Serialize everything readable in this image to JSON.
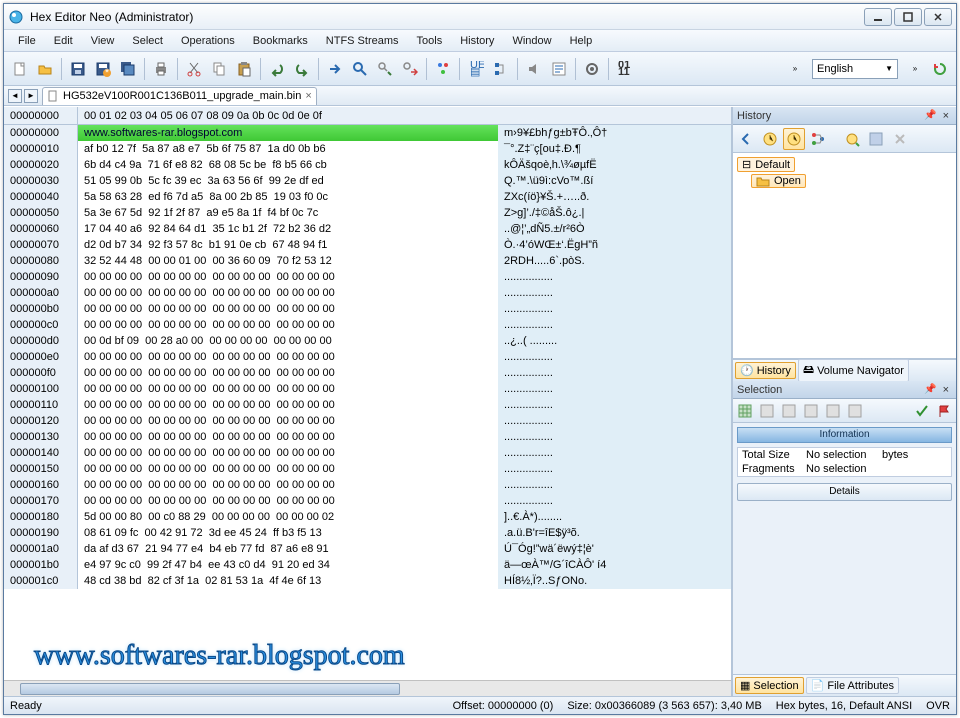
{
  "window": {
    "title": "Hex Editor Neo (Administrator)"
  },
  "menus": [
    "File",
    "Edit",
    "View",
    "Select",
    "Operations",
    "Bookmarks",
    "NTFS Streams",
    "Tools",
    "History",
    "Window",
    "Help"
  ],
  "language": "English",
  "tab": {
    "filename": "HG532eV100R001C136B011_upgrade_main.bin"
  },
  "hex": {
    "offset_header": "00000000",
    "col_header": "00 01 02 03  04 05 06 07  08 09 0a 0b  0c 0d 0e 0f",
    "rows": [
      {
        "off": "00000000",
        "b": "www.softwares-rar.blogspot.com",
        "a": "m›9¥£bhƒg±bŦÔ.‚Ô†"
      },
      {
        "off": "00000010",
        "b": "af b0 12 7f  5a 87 a8 e7  5b 6f 75 87  1a d0 0b b6",
        "a": "¯°.Z‡¨ç[ou‡.Ð.¶"
      },
      {
        "off": "00000020",
        "b": "6b d4 c4 9a  71 6f e8 82  68 08 5c be  f8 b5 66 cb",
        "a": "kÔÄšqoè‚h.\\¾øµfË"
      },
      {
        "off": "00000030",
        "b": "51 05 99 0b  5c fc 39 ec  3a 63 56 6f  99 2e df ed",
        "a": "Q.™.\\ü9ì:cVo™.ßí"
      },
      {
        "off": "00000040",
        "b": "5a 58 63 28  ed f6 7d a5  8a 00 2b 85  19 03 f0 0c",
        "a": "ZXc(íö}¥Š.+…..ð."
      },
      {
        "off": "00000050",
        "b": "5a 3e 67 5d  92 1f 2f 87  a9 e5 8a 1f  f4 bf 0c 7c",
        "a": "Z>g]’./‡©åŠ.ô¿.|"
      },
      {
        "off": "00000060",
        "b": "17 04 40 a6  92 84 64 d1  35 1c b1 2f  72 b2 36 d2",
        "a": "..@¦’„dÑ5.±/r²6Ò"
      },
      {
        "off": "00000070",
        "b": "d2 0d b7 34  92 f3 57 8c  b1 91 0e cb  67 48 94 f1",
        "a": "Ò.·4’óWŒ±‘.ËgH”ñ"
      },
      {
        "off": "00000080",
        "b": "32 52 44 48  00 00 01 00  00 36 60 09  70 f2 53 12",
        "a": "2RDH.....6`.pòS."
      },
      {
        "off": "00000090",
        "b": "00 00 00 00  00 00 00 00  00 00 00 00  00 00 00 00",
        "a": "................"
      },
      {
        "off": "000000a0",
        "b": "00 00 00 00  00 00 00 00  00 00 00 00  00 00 00 00",
        "a": "................"
      },
      {
        "off": "000000b0",
        "b": "00 00 00 00  00 00 00 00  00 00 00 00  00 00 00 00",
        "a": "................"
      },
      {
        "off": "000000c0",
        "b": "00 00 00 00  00 00 00 00  00 00 00 00  00 00 00 00",
        "a": "................"
      },
      {
        "off": "000000d0",
        "b": "00 0d bf 09  00 28 a0 00  00 00 00 00  00 00 00 00",
        "a": "..¿..( ........."
      },
      {
        "off": "000000e0",
        "b": "00 00 00 00  00 00 00 00  00 00 00 00  00 00 00 00",
        "a": "................"
      },
      {
        "off": "000000f0",
        "b": "00 00 00 00  00 00 00 00  00 00 00 00  00 00 00 00",
        "a": "................"
      },
      {
        "off": "00000100",
        "b": "00 00 00 00  00 00 00 00  00 00 00 00  00 00 00 00",
        "a": "................"
      },
      {
        "off": "00000110",
        "b": "00 00 00 00  00 00 00 00  00 00 00 00  00 00 00 00",
        "a": "................"
      },
      {
        "off": "00000120",
        "b": "00 00 00 00  00 00 00 00  00 00 00 00  00 00 00 00",
        "a": "................"
      },
      {
        "off": "00000130",
        "b": "00 00 00 00  00 00 00 00  00 00 00 00  00 00 00 00",
        "a": "................"
      },
      {
        "off": "00000140",
        "b": "00 00 00 00  00 00 00 00  00 00 00 00  00 00 00 00",
        "a": "................"
      },
      {
        "off": "00000150",
        "b": "00 00 00 00  00 00 00 00  00 00 00 00  00 00 00 00",
        "a": "................"
      },
      {
        "off": "00000160",
        "b": "00 00 00 00  00 00 00 00  00 00 00 00  00 00 00 00",
        "a": "................"
      },
      {
        "off": "00000170",
        "b": "00 00 00 00  00 00 00 00  00 00 00 00  00 00 00 00",
        "a": "................"
      },
      {
        "off": "00000180",
        "b": "5d 00 00 80  00 c0 88 29  00 00 00 00  00 00 00 02",
        "a": "]..€.À*)........"
      },
      {
        "off": "00000190",
        "b": "08 61 09 fc  00 42 91 72  3d ee 45 24  ff b3 f5 13",
        "a": ".a.ü.B'r=îE$ÿ³õ."
      },
      {
        "off": "000001a0",
        "b": "da af d3 67  21 94 77 e4  b4 eb 77 fd  87 a6 e8 91",
        "a": "Ú¯Óg!”wä´ëwý‡¦è'"
      },
      {
        "off": "000001b0",
        "b": "e4 97 9c c0  99 2f 47 b4  ee 43 c0 d4  91 20 ed 34",
        "a": "ä—œÀ™/G´îCÀÔ' í4"
      },
      {
        "off": "000001c0",
        "b": "48 cd 38 bd  82 cf 3f 1a  02 81 53 1a  4f 4e 6f 13",
        "a": "HÍ8½‚Ï?..SƒONo."
      }
    ]
  },
  "history": {
    "panel_title": "History",
    "root": "Default",
    "items": [
      "Open"
    ],
    "tab_history": "History",
    "tab_volnav": "Volume Navigator"
  },
  "selection": {
    "panel_title": "Selection",
    "info_header": "Information",
    "total_size_label": "Total Size",
    "total_size_value": "No selection",
    "total_size_unit": "bytes",
    "frag_label": "Fragments",
    "frag_value": "No selection",
    "details": "Details",
    "tab_selection": "Selection",
    "tab_fileattr": "File Attributes"
  },
  "status": {
    "ready": "Ready",
    "offset": "Offset: 00000000 (0)",
    "size": "Size: 0x00366089 (3 563 657): 3,40 MB",
    "mode": "Hex bytes, 16, Default ANSI",
    "ovr": "OVR"
  },
  "watermark": "www.softwares-rar.blogspot.com"
}
